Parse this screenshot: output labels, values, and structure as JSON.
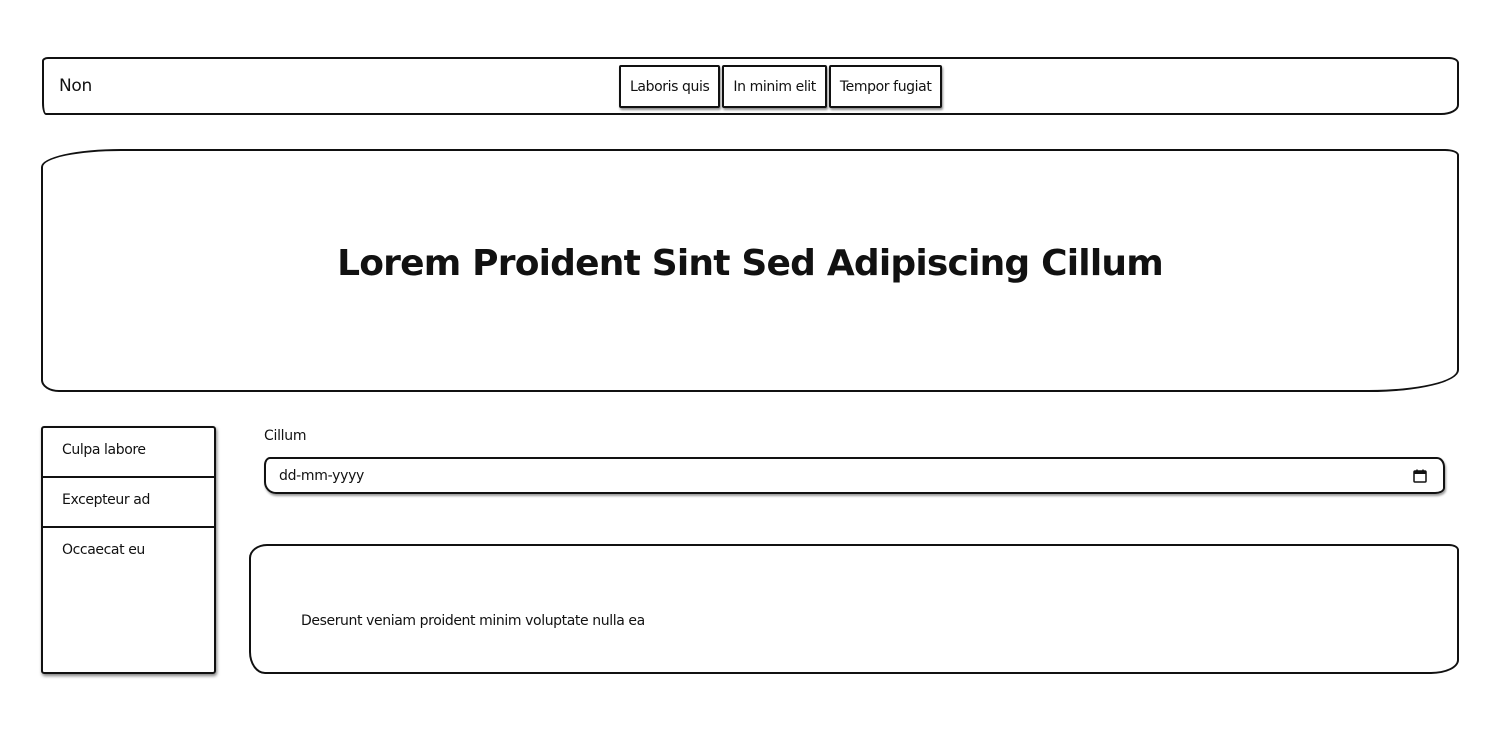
{
  "navbar": {
    "brand": "Non",
    "links": [
      {
        "label": "Laboris quis"
      },
      {
        "label": "In minim elit"
      },
      {
        "label": "Tempor fugiat"
      }
    ]
  },
  "hero": {
    "title": "Lorem Proident Sint Sed Adipiscing Cillum"
  },
  "sidebar": {
    "items": [
      {
        "label": "Culpa labore"
      },
      {
        "label": "Excepteur ad"
      },
      {
        "label": "Occaecat eu"
      }
    ]
  },
  "form": {
    "date_label": "Cillum",
    "date_placeholder": "dd-mm-yyyy"
  },
  "card": {
    "text": "Deserunt veniam proident minim voluptate nulla ea"
  },
  "icons": {
    "date_picker": "calendar-icon"
  }
}
